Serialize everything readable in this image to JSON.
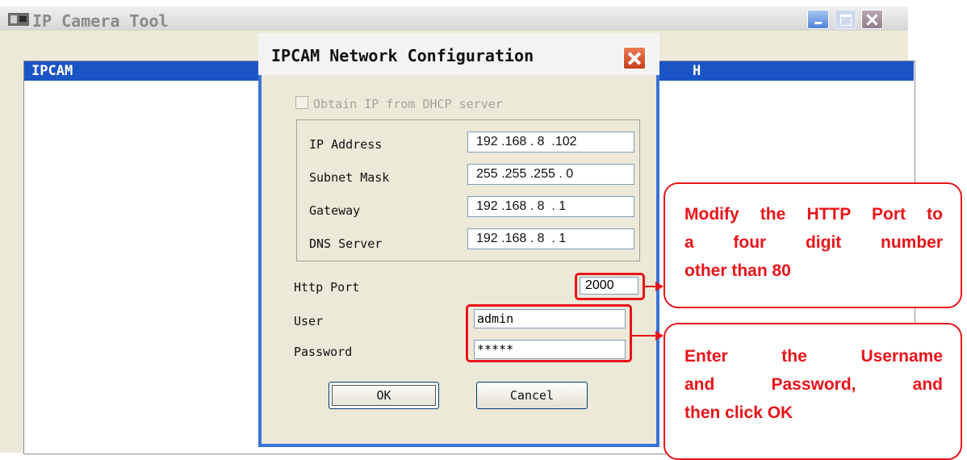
{
  "main_window": {
    "title": "IP Camera Tool",
    "list_columns": [
      "IPCAM",
      "H"
    ]
  },
  "dialog": {
    "title": "IPCAM Network Configuration",
    "dhcp_label": "Obtain IP from DHCP server",
    "dhcp_checked": false,
    "ip_address_label": "IP Address",
    "ip_address": "192 .168 . 8  .102",
    "subnet_mask_label": "Subnet Mask",
    "subnet_mask": "255 .255 .255 . 0",
    "gateway_label": "Gateway",
    "gateway": "192 .168 . 8  . 1",
    "dns_server_label": "DNS Server",
    "dns_server": "192 .168 . 8  . 1",
    "http_port_label": "Http Port",
    "http_port": "2000",
    "user_label": "User",
    "user": "admin",
    "password_label": "Password",
    "password": "*****",
    "ok_label": "OK",
    "cancel_label": "Cancel"
  },
  "annotations": {
    "port_note": [
      "Modify the HTTP Port to",
      "a four digit number",
      "other than 80"
    ],
    "login_note": [
      "Enter the Username",
      "and Password, and",
      "then click OK"
    ]
  },
  "colors": {
    "annotation_red": "#e8141a",
    "list_header_blue": "#1b54c4",
    "dialog_frame_blue": "#3b73d7"
  }
}
